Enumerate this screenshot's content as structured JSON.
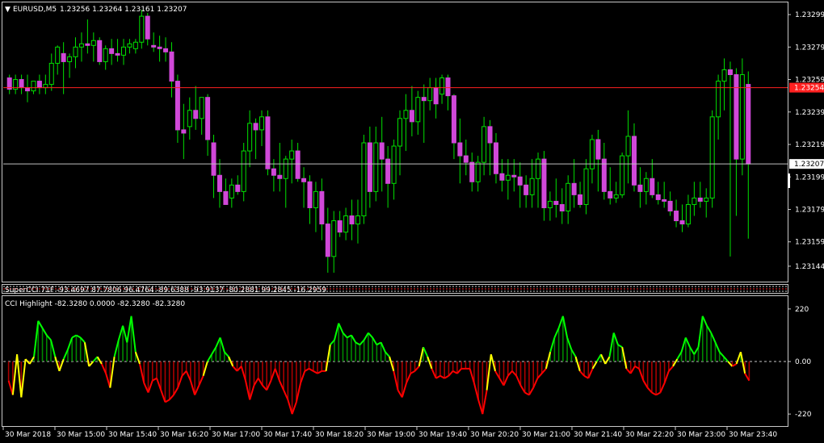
{
  "header": {
    "symbol": "EURUSD,M5",
    "ohlc": "1.23256 1.23264 1.23161 1.23207"
  },
  "subwindow1": {
    "label": "SuperCCI 71F -93.4697 87.7806 96.4764 -89.6388 -93.9137 -80.2881 99.2845 -16.2959"
  },
  "subwindow2": {
    "label": "CCI Highlight -82.3280 0.0000 -82.3280 -82.3280"
  },
  "colors": {
    "bull_body": "#000000",
    "bull_wick": "#00e000",
    "bear_body": "#d048d8",
    "level_line": "#ff2020",
    "bid_line": "#c0c0c0",
    "cci_high": "#00ff00",
    "cci_low": "#ff0000",
    "cci_turn": "#ffff00"
  },
  "chart_data": [
    {
      "type": "candlestick",
      "price_ticks": [
        "1.23299",
        "1.23279",
        "1.23259",
        "1.23239",
        "1.23219",
        "1.23199",
        "1.23179",
        "1.23159",
        "1.23144"
      ],
      "ylim": [
        1.23135,
        1.23306
      ],
      "red_line": {
        "value": 1.23254,
        "label": "1.23254"
      },
      "bid_line": {
        "value": 1.23207,
        "label": "1.23207"
      },
      "candles": [
        [
          1.2326,
          1.23262,
          1.2325,
          1.23253
        ],
        [
          1.23253,
          1.23262,
          1.2325,
          1.23259
        ],
        [
          1.23259,
          1.23262,
          1.2325,
          1.23254
        ],
        [
          1.23254,
          1.23262,
          1.23245,
          1.23252
        ],
        [
          1.23252,
          1.23258,
          1.2325,
          1.23258
        ],
        [
          1.23258,
          1.23262,
          1.2325,
          1.23254
        ],
        [
          1.23254,
          1.23262,
          1.2325,
          1.23256
        ],
        [
          1.23256,
          1.23275,
          1.23252,
          1.23269
        ],
        [
          1.23269,
          1.2328,
          1.23262,
          1.23279
        ],
        [
          1.23275,
          1.23282,
          1.2325,
          1.2327
        ],
        [
          1.2327,
          1.23275,
          1.2326,
          1.23273
        ],
        [
          1.23273,
          1.23285,
          1.23266,
          1.23279
        ],
        [
          1.23279,
          1.23288,
          1.2327,
          1.23281
        ],
        [
          1.23281,
          1.23296,
          1.23275,
          1.2328
        ],
        [
          1.2328,
          1.23288,
          1.2327,
          1.23283
        ],
        [
          1.23283,
          1.23285,
          1.23268,
          1.2327
        ],
        [
          1.2327,
          1.2328,
          1.23265,
          1.23278
        ],
        [
          1.23278,
          1.23284,
          1.23268,
          1.23275
        ],
        [
          1.23275,
          1.23284,
          1.2327,
          1.23274
        ],
        [
          1.23274,
          1.23284,
          1.23268,
          1.23279
        ],
        [
          1.23279,
          1.23284,
          1.23275,
          1.23281
        ],
        [
          1.23278,
          1.23284,
          1.23275,
          1.23282
        ],
        [
          1.23282,
          1.23302,
          1.23278,
          1.23298
        ],
        [
          1.23298,
          1.233,
          1.2328,
          1.23284
        ],
        [
          1.2328,
          1.23288,
          1.23276,
          1.23279
        ],
        [
          1.23279,
          1.23286,
          1.2327,
          1.23278
        ],
        [
          1.23278,
          1.23285,
          1.2327,
          1.23276
        ],
        [
          1.23276,
          1.23282,
          1.23248,
          1.23258
        ],
        [
          1.23258,
          1.23262,
          1.2322,
          1.23228
        ],
        [
          1.23228,
          1.23244,
          1.2321,
          1.23226
        ],
        [
          1.2323,
          1.23248,
          1.23222,
          1.2324
        ],
        [
          1.2324,
          1.23255,
          1.23228,
          1.23235
        ],
        [
          1.23235,
          1.23248,
          1.23225,
          1.23248
        ],
        [
          1.23248,
          1.2325,
          1.23212,
          1.23222
        ],
        [
          1.2322,
          1.23225,
          1.23186,
          1.232
        ],
        [
          1.232,
          1.2321,
          1.2318,
          1.2319
        ],
        [
          1.2319,
          1.23198,
          1.23182,
          1.23182
        ],
        [
          1.23186,
          1.23198,
          1.2318,
          1.23194
        ],
        [
          1.23194,
          1.232,
          1.23188,
          1.2319
        ],
        [
          1.2319,
          1.2322,
          1.23184,
          1.23215
        ],
        [
          1.23215,
          1.2324,
          1.23205,
          1.23232
        ],
        [
          1.23232,
          1.23235,
          1.2321,
          1.23228
        ],
        [
          1.23228,
          1.2324,
          1.23218,
          1.23236
        ],
        [
          1.23236,
          1.2324,
          1.232,
          1.23204
        ],
        [
          1.23204,
          1.2321,
          1.2319,
          1.232
        ],
        [
          1.232,
          1.2322,
          1.2319,
          1.23198
        ],
        [
          1.23198,
          1.23212,
          1.2318,
          1.2321
        ],
        [
          1.2321,
          1.23222,
          1.23195,
          1.23215
        ],
        [
          1.23215,
          1.2322,
          1.23196,
          1.23198
        ],
        [
          1.23198,
          1.23205,
          1.2318,
          1.23196
        ],
        [
          1.23196,
          1.232,
          1.2317,
          1.2318
        ],
        [
          1.2318,
          1.23196,
          1.23165,
          1.2319
        ],
        [
          1.2319,
          1.23198,
          1.2316,
          1.2317
        ],
        [
          1.2317,
          1.2318,
          1.2314,
          1.2315
        ],
        [
          1.2315,
          1.23178,
          1.2314,
          1.23172
        ],
        [
          1.23172,
          1.23178,
          1.23162,
          1.23165
        ],
        [
          1.23165,
          1.2318,
          1.2316,
          1.23175
        ],
        [
          1.23175,
          1.23185,
          1.2316,
          1.2317
        ],
        [
          1.2317,
          1.23185,
          1.23158,
          1.23175
        ],
        [
          1.23175,
          1.23225,
          1.2317,
          1.2322
        ],
        [
          1.2322,
          1.2323,
          1.2318,
          1.2319
        ],
        [
          1.2319,
          1.2323,
          1.23184,
          1.2322
        ],
        [
          1.2322,
          1.23236,
          1.2319,
          1.2321
        ],
        [
          1.2321,
          1.23218,
          1.2318,
          1.23195
        ],
        [
          1.23195,
          1.23222,
          1.23185,
          1.23218
        ],
        [
          1.23218,
          1.2324,
          1.232,
          1.23235
        ],
        [
          1.23235,
          1.2325,
          1.23215,
          1.2324
        ],
        [
          1.2324,
          1.23255,
          1.23224,
          1.23233
        ],
        [
          1.23233,
          1.23252,
          1.23225,
          1.23248
        ],
        [
          1.23248,
          1.23256,
          1.2322,
          1.23246
        ],
        [
          1.23246,
          1.2326,
          1.2324,
          1.23254
        ],
        [
          1.23254,
          1.2326,
          1.23235,
          1.23244
        ],
        [
          1.2325,
          1.23262,
          1.23244,
          1.2326
        ],
        [
          1.2326,
          1.23262,
          1.2324,
          1.23249
        ],
        [
          1.23249,
          1.2325,
          1.2321,
          1.2322
        ],
        [
          1.2322,
          1.23235,
          1.23195,
          1.23212
        ],
        [
          1.23212,
          1.23222,
          1.232,
          1.23208
        ],
        [
          1.23208,
          1.23214,
          1.2319,
          1.23196
        ],
        [
          1.23196,
          1.23212,
          1.2319,
          1.23208
        ],
        [
          1.23208,
          1.23236,
          1.232,
          1.2323
        ],
        [
          1.2323,
          1.23234,
          1.232,
          1.2322
        ],
        [
          1.2322,
          1.23226,
          1.23195,
          1.23201
        ],
        [
          1.23201,
          1.2321,
          1.2319,
          1.23197
        ],
        [
          1.23197,
          1.2321,
          1.23185,
          1.232
        ],
        [
          1.232,
          1.2321,
          1.2319,
          1.23199
        ],
        [
          1.23199,
          1.23208,
          1.2318,
          1.23194
        ],
        [
          1.23194,
          1.232,
          1.2318,
          1.23188
        ],
        [
          1.23188,
          1.2321,
          1.2318,
          1.23198
        ],
        [
          1.23198,
          1.23214,
          1.2318,
          1.2321
        ],
        [
          1.2321,
          1.23215,
          1.23172,
          1.2318
        ],
        [
          1.2318,
          1.2319,
          1.23172,
          1.23184
        ],
        [
          1.23184,
          1.23198,
          1.23174,
          1.23182
        ],
        [
          1.23182,
          1.23192,
          1.2317,
          1.23178
        ],
        [
          1.23178,
          1.232,
          1.2317,
          1.23195
        ],
        [
          1.23195,
          1.2321,
          1.2318,
          1.23188
        ],
        [
          1.23188,
          1.23196,
          1.2318,
          1.23182
        ],
        [
          1.23182,
          1.2321,
          1.23176,
          1.23204
        ],
        [
          1.23204,
          1.23225,
          1.23195,
          1.23222
        ],
        [
          1.23222,
          1.23228,
          1.2319,
          1.2321
        ],
        [
          1.2321,
          1.2322,
          1.23185,
          1.2319
        ],
        [
          1.2319,
          1.23205,
          1.23182,
          1.23186
        ],
        [
          1.23186,
          1.23196,
          1.23183,
          1.23188
        ],
        [
          1.23188,
          1.23214,
          1.23186,
          1.23212
        ],
        [
          1.23212,
          1.2324,
          1.23195,
          1.23224
        ],
        [
          1.23224,
          1.23232,
          1.2319,
          1.23194
        ],
        [
          1.23194,
          1.23205,
          1.2318,
          1.2319
        ],
        [
          1.2319,
          1.23202,
          1.23182,
          1.23198
        ],
        [
          1.23198,
          1.2321,
          1.23186,
          1.23188
        ],
        [
          1.23188,
          1.23196,
          1.23182,
          1.23185
        ],
        [
          1.23185,
          1.23196,
          1.2318,
          1.23184
        ],
        [
          1.23184,
          1.2319,
          1.23175,
          1.23178
        ],
        [
          1.23178,
          1.23185,
          1.23168,
          1.23172
        ],
        [
          1.23172,
          1.23182,
          1.23165,
          1.2317
        ],
        [
          1.2317,
          1.23188,
          1.23168,
          1.23182
        ],
        [
          1.23182,
          1.23196,
          1.23175,
          1.23186
        ],
        [
          1.23186,
          1.23196,
          1.2318,
          1.23184
        ],
        [
          1.23184,
          1.23192,
          1.23174,
          1.23186
        ],
        [
          1.23186,
          1.2324,
          1.2318,
          1.23236
        ],
        [
          1.23236,
          1.23262,
          1.23222,
          1.23258
        ],
        [
          1.23258,
          1.23272,
          1.2324,
          1.23265
        ],
        [
          1.23265,
          1.2327,
          1.2315,
          1.23262
        ],
        [
          1.23262,
          1.23266,
          1.23175,
          1.2321
        ],
        [
          1.2321,
          1.23272,
          1.232,
          1.23262
        ],
        [
          1.23256,
          1.23264,
          1.23161,
          1.23207
        ]
      ]
    },
    {
      "type": "bar",
      "title": "CCI Highlight",
      "ylim": [
        -250,
        250
      ],
      "ticks": [
        "220",
        "0.00",
        "-220"
      ],
      "values": [
        -80,
        -140,
        30,
        -150,
        10,
        -10,
        20,
        170,
        140,
        110,
        90,
        20,
        -40,
        10,
        50,
        100,
        110,
        100,
        80,
        -20,
        0,
        20,
        -10,
        -50,
        -110,
        20,
        90,
        150,
        80,
        190,
        40,
        -10,
        -90,
        -130,
        -80,
        -70,
        -120,
        -170,
        -160,
        -140,
        -110,
        -60,
        -40,
        -80,
        -140,
        -100,
        -60,
        0,
        30,
        60,
        100,
        40,
        20,
        -20,
        -40,
        -20,
        -80,
        -160,
        -100,
        -70,
        -100,
        -120,
        -80,
        -30,
        -80,
        -120,
        -160,
        -220,
        -170,
        -90,
        -40,
        -30,
        -40,
        -50,
        -40,
        -40,
        70,
        90,
        160,
        120,
        100,
        110,
        80,
        70,
        90,
        120,
        100,
        70,
        80,
        40,
        20,
        -40,
        -120,
        -150,
        -90,
        -50,
        -40,
        -20,
        60,
        20,
        -30,
        -70,
        -60,
        -70,
        -60,
        -40,
        -50,
        -30,
        -30,
        -30,
        -90,
        -160,
        -220,
        -120,
        30,
        -40,
        -70,
        -100,
        -60,
        -40,
        -60,
        -100,
        -130,
        -140,
        -110,
        -70,
        -50,
        -30,
        40,
        100,
        140,
        190,
        100,
        50,
        20,
        -40,
        -60,
        -70,
        -30,
        0,
        30,
        -10,
        20,
        120,
        70,
        60,
        -30,
        -50,
        -20,
        -30,
        -80,
        -110,
        -130,
        -140,
        -130,
        -90,
        -40,
        -20,
        10,
        40,
        100,
        60,
        30,
        60,
        190,
        150,
        120,
        80,
        40,
        20,
        0,
        -20,
        -10,
        40,
        -50,
        -80
      ]
    }
  ],
  "time_axis": {
    "labels": [
      "30 Mar 2018",
      "30 Mar 15:00",
      "30 Mar 15:40",
      "30 Mar 16:20",
      "30 Mar 17:00",
      "30 Mar 17:40",
      "30 Mar 18:20",
      "30 Mar 19:00",
      "30 Mar 19:40",
      "30 Mar 20:20",
      "30 Mar 21:00",
      "30 Mar 21:40",
      "30 Mar 22:20",
      "30 Mar 23:00",
      "30 Mar 23:40"
    ]
  }
}
